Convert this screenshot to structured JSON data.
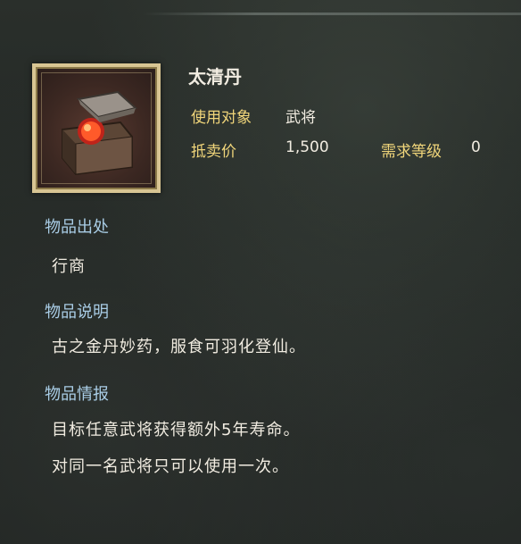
{
  "item": {
    "name": "太清丹",
    "use_target_label": "使用对象",
    "use_target_value": "武将",
    "price_label": "抵卖价",
    "price_value": "1,500",
    "level_label": "需求等级",
    "level_value": "0",
    "icon": "pill-box-icon"
  },
  "sections": {
    "source": {
      "heading": "物品出处",
      "lines": [
        "行商"
      ]
    },
    "description": {
      "heading": "物品说明",
      "lines": [
        "古之金丹妙药，服食可羽化登仙。"
      ]
    },
    "info": {
      "heading": "物品情报",
      "lines": [
        "目标任意武将获得额外5年寿命。",
        "对同一名武将只可以使用一次。"
      ]
    }
  },
  "colors": {
    "title": "#f1ece1",
    "label": "#f0d57a",
    "section_heading": "#a9cde6",
    "frame": "#d8c593"
  }
}
